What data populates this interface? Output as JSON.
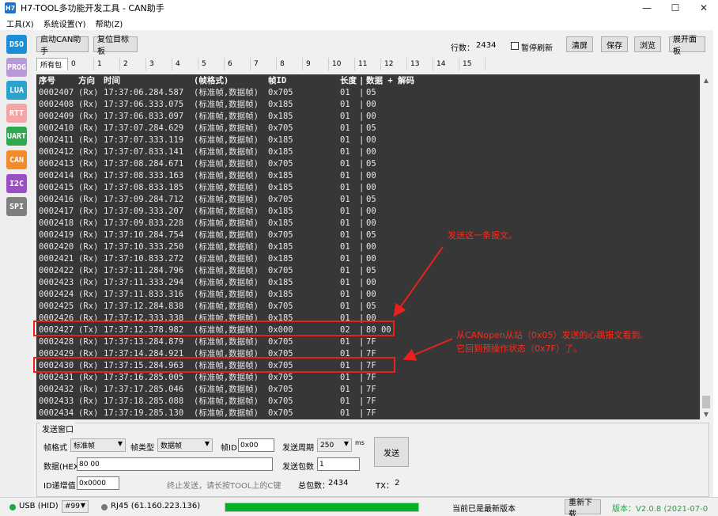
{
  "window": {
    "icon_text": "H7",
    "title": "H7-TOOL多功能开发工具 - CAN助手",
    "minimize_icon": "minimize-icon",
    "maximize_icon": "maximize-icon",
    "close_icon": "close-icon"
  },
  "menu": [
    "工具(X)",
    "系统设置(Y)",
    "帮助(Z)"
  ],
  "sidebar": [
    {
      "label": "DSO",
      "color": "#1a8fd8"
    },
    {
      "label": "PROG",
      "color": "#b79ad6"
    },
    {
      "label": "LUA",
      "color": "#2aa3cf"
    },
    {
      "label": "RTT",
      "color": "#f4a6a6"
    },
    {
      "label": "UART",
      "color": "#2fa84f"
    },
    {
      "label": "CAN",
      "color": "#f28c28"
    },
    {
      "label": "I2C",
      "color": "#9b4fc4"
    },
    {
      "label": "SPI",
      "color": "#7f7f7f"
    }
  ],
  "toolbar": {
    "start_can": "启动CAN助手",
    "reset_target": "复位目标板",
    "row_count_label": "行数：",
    "row_count": "2434",
    "pause_refresh": "暂停刷新",
    "clear": "清屏",
    "save": "保存",
    "browse": "浏览",
    "expand_panel": "展开面板"
  },
  "tabs": [
    "所有包",
    "0",
    "1",
    "2",
    "3",
    "4",
    "5",
    "6",
    "7",
    "8",
    "9",
    "10",
    "11",
    "12",
    "13",
    "14",
    "15"
  ],
  "terminal": {
    "headers": [
      "序号",
      "方向",
      "时间",
      "(帧格式)",
      "帧ID",
      "长度",
      "|",
      "数据 + 解码"
    ],
    "rows": [
      [
        "0002407",
        "(Rx)",
        "17:37:06.284.587",
        "(标准帧,数据帧)",
        "0x705",
        "01",
        "|",
        "05"
      ],
      [
        "0002408",
        "(Rx)",
        "17:37:06.333.075",
        "(标准帧,数据帧)",
        "0x185",
        "01",
        "|",
        "00"
      ],
      [
        "0002409",
        "(Rx)",
        "17:37:06.833.097",
        "(标准帧,数据帧)",
        "0x185",
        "01",
        "|",
        "00"
      ],
      [
        "0002410",
        "(Rx)",
        "17:37:07.284.629",
        "(标准帧,数据帧)",
        "0x705",
        "01",
        "|",
        "05"
      ],
      [
        "0002411",
        "(Rx)",
        "17:37:07.333.119",
        "(标准帧,数据帧)",
        "0x185",
        "01",
        "|",
        "00"
      ],
      [
        "0002412",
        "(Rx)",
        "17:37:07.833.141",
        "(标准帧,数据帧)",
        "0x185",
        "01",
        "|",
        "00"
      ],
      [
        "0002413",
        "(Rx)",
        "17:37:08.284.671",
        "(标准帧,数据帧)",
        "0x705",
        "01",
        "|",
        "05"
      ],
      [
        "0002414",
        "(Rx)",
        "17:37:08.333.163",
        "(标准帧,数据帧)",
        "0x185",
        "01",
        "|",
        "00"
      ],
      [
        "0002415",
        "(Rx)",
        "17:37:08.833.185",
        "(标准帧,数据帧)",
        "0x185",
        "01",
        "|",
        "00"
      ],
      [
        "0002416",
        "(Rx)",
        "17:37:09.284.712",
        "(标准帧,数据帧)",
        "0x705",
        "01",
        "|",
        "05"
      ],
      [
        "0002417",
        "(Rx)",
        "17:37:09.333.207",
        "(标准帧,数据帧)",
        "0x185",
        "01",
        "|",
        "00"
      ],
      [
        "0002418",
        "(Rx)",
        "17:37:09.833.228",
        "(标准帧,数据帧)",
        "0x185",
        "01",
        "|",
        "00"
      ],
      [
        "0002419",
        "(Rx)",
        "17:37:10.284.754",
        "(标准帧,数据帧)",
        "0x705",
        "01",
        "|",
        "05"
      ],
      [
        "0002420",
        "(Rx)",
        "17:37:10.333.250",
        "(标准帧,数据帧)",
        "0x185",
        "01",
        "|",
        "00"
      ],
      [
        "0002421",
        "(Rx)",
        "17:37:10.833.272",
        "(标准帧,数据帧)",
        "0x185",
        "01",
        "|",
        "00"
      ],
      [
        "0002422",
        "(Rx)",
        "17:37:11.284.796",
        "(标准帧,数据帧)",
        "0x705",
        "01",
        "|",
        "05"
      ],
      [
        "0002423",
        "(Rx)",
        "17:37:11.333.294",
        "(标准帧,数据帧)",
        "0x185",
        "01",
        "|",
        "00"
      ],
      [
        "0002424",
        "(Rx)",
        "17:37:11.833.316",
        "(标准帧,数据帧)",
        "0x185",
        "01",
        "|",
        "00"
      ],
      [
        "0002425",
        "(Rx)",
        "17:37:12.284.838",
        "(标准帧,数据帧)",
        "0x705",
        "01",
        "|",
        "05"
      ],
      [
        "0002426",
        "(Rx)",
        "17:37:12.333.338",
        "(标准帧,数据帧)",
        "0x185",
        "01",
        "|",
        "00"
      ],
      [
        "0002427",
        "(Tx)",
        "17:37:12.378.982",
        "(标准帧,数据帧)",
        "0x000",
        "02",
        "|",
        "80 00"
      ],
      [
        "0002428",
        "(Rx)",
        "17:37:13.284.879",
        "(标准帧,数据帧)",
        "0x705",
        "01",
        "|",
        "7F"
      ],
      [
        "0002429",
        "(Rx)",
        "17:37:14.284.921",
        "(标准帧,数据帧)",
        "0x705",
        "01",
        "|",
        "7F"
      ],
      [
        "0002430",
        "(Rx)",
        "17:37:15.284.963",
        "(标准帧,数据帧)",
        "0x705",
        "01",
        "|",
        "7F"
      ],
      [
        "0002431",
        "(Rx)",
        "17:37:16.285.005",
        "(标准帧,数据帧)",
        "0x705",
        "01",
        "|",
        "7F"
      ],
      [
        "0002432",
        "(Rx)",
        "17:37:17.285.046",
        "(标准帧,数据帧)",
        "0x705",
        "01",
        "|",
        "7F"
      ],
      [
        "0002433",
        "(Rx)",
        "17:37:18.285.088",
        "(标准帧,数据帧)",
        "0x705",
        "01",
        "|",
        "7F"
      ],
      [
        "0002434",
        "(Rx)",
        "17:37:19.285.130",
        "(标准帧,数据帧)",
        "0x705",
        "01",
        "|",
        "7F"
      ]
    ]
  },
  "send": {
    "title": "发送窗口",
    "frame_format_label": "帧格式",
    "frame_format_value": "标准帧",
    "frame_type_label": "帧类型",
    "frame_type_value": "数据帧",
    "frame_id_label": "帧ID",
    "frame_id_value": "0x00",
    "period_label": "发送周期",
    "period_value": "250",
    "period_unit": "ms",
    "data_label": "数据(HEX)",
    "data_value": "80 00",
    "count_label": "发送包数",
    "count_value": "1",
    "send_button": "发送",
    "id_inc_label": "ID递增值",
    "id_inc_value": "0x0000",
    "stop_msg": "终止发送，请长按TOOL上的C键",
    "total_label": "总包数：",
    "total_value": "2434",
    "tx_label": "TX：",
    "tx_value": "2"
  },
  "status": {
    "usb": "USB (HID)",
    "device": "#99",
    "rj45": "RJ45 (61.160.223.136)",
    "progress_fraction": 1.0,
    "latest": "当前已是最新版本",
    "upgrade_button": "重新下载",
    "version": "版本：V2.0.8 (2021-07-0",
    "green": "#1aa83c",
    "gray": "#777777"
  },
  "annotations": {
    "send_note": "发送这一条报文。",
    "heartbeat_line1": "从CANopen从站（0x05）发送的心跳报文看到,",
    "heartbeat_line2": "它回到预操作状态（0x7F）了。",
    "color": "#e8211c"
  }
}
